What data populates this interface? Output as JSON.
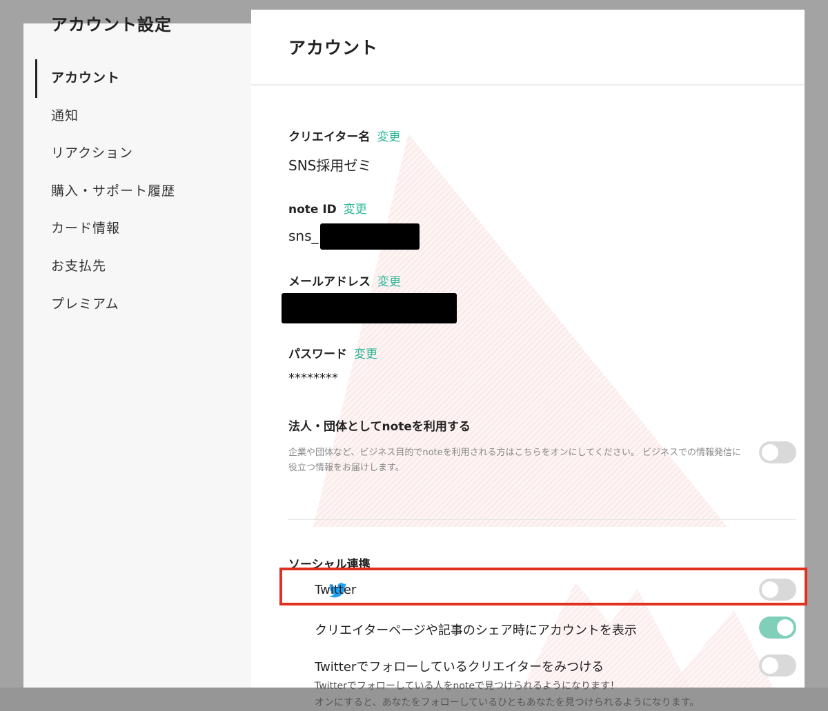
{
  "sidebar": {
    "title": "アカウント設定",
    "items": [
      {
        "label": "アカウント",
        "active": true
      },
      {
        "label": "通知"
      },
      {
        "label": "リアクション"
      },
      {
        "label": "購入・サポート履歴"
      },
      {
        "label": "カード情報"
      },
      {
        "label": "お支払先"
      },
      {
        "label": "プレミアム"
      }
    ]
  },
  "main": {
    "title": "アカウント",
    "change_label": "変更",
    "fields": {
      "creator_name": {
        "label": "クリエイター名",
        "value": "SNS採用ゼミ"
      },
      "note_id": {
        "label": "note ID",
        "value": "sns_"
      },
      "email": {
        "label": "メールアドレス"
      },
      "password": {
        "label": "パスワード",
        "value": "********"
      }
    },
    "corporate": {
      "label": "法人・団体としてnoteを利用する",
      "description": "企業や団体など、ビジネス目的でnoteを利用される方はこちらをオンにしてください。 ビジネスでの情報発信に役立つ情報をお届けします。",
      "enabled": false
    },
    "social": {
      "title": "ソーシャル連携",
      "twitter": {
        "label": "Twitter",
        "enabled": false
      },
      "show_account": {
        "label": "クリエイターページや記事のシェア時にアカウントを表示",
        "enabled": true
      },
      "find_creators": {
        "label": "Twitterでフォローしているクリエイターをみつける",
        "enabled": false,
        "description_1": "Twitterでフォローしている人をnoteで見つけられるようになります！",
        "description_2": "オンにすると、あなたをフォローしているひともあなたを見つけられるようになります。"
      }
    }
  },
  "colors": {
    "accent": "#2cb696",
    "toggle_on": "#7fcfb9",
    "toggle_off": "#d9d9d9",
    "highlight": "#e0301e",
    "twitter_blue": "#1da1f2"
  },
  "icons": {
    "twitter": "twitter-bird-icon"
  }
}
